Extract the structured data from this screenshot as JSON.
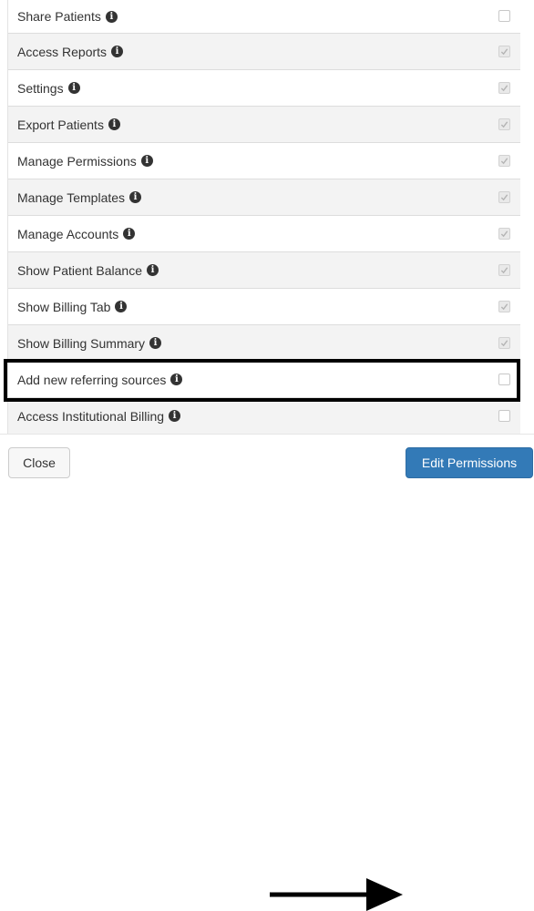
{
  "permissions": [
    {
      "label": "Share Patients",
      "checked": false
    },
    {
      "label": "Access Reports",
      "checked": true
    },
    {
      "label": "Settings",
      "checked": true
    },
    {
      "label": "Export Patients",
      "checked": true
    },
    {
      "label": "Manage Permissions",
      "checked": true
    },
    {
      "label": "Manage Templates",
      "checked": true
    },
    {
      "label": "Manage Accounts",
      "checked": true
    },
    {
      "label": "Show Patient Balance",
      "checked": true
    },
    {
      "label": "Show Billing Tab",
      "checked": true
    },
    {
      "label": "Show Billing Summary",
      "checked": true
    },
    {
      "label": "Add new referring sources",
      "checked": false
    },
    {
      "label": "Access Institutional Billing",
      "checked": false
    }
  ],
  "info_icon_glyph": "i",
  "highlighted_item": "Add new referring sources",
  "footer": {
    "close_label": "Close",
    "edit_label": "Edit Permissions"
  },
  "colors": {
    "primary": "#337ab7",
    "row_stripe": "#f3f3f3",
    "annotation": "#000000"
  },
  "icons": {
    "info": "info-circle-icon",
    "checkbox": "checkbox-icon",
    "arrow": "right-arrow-icon"
  }
}
